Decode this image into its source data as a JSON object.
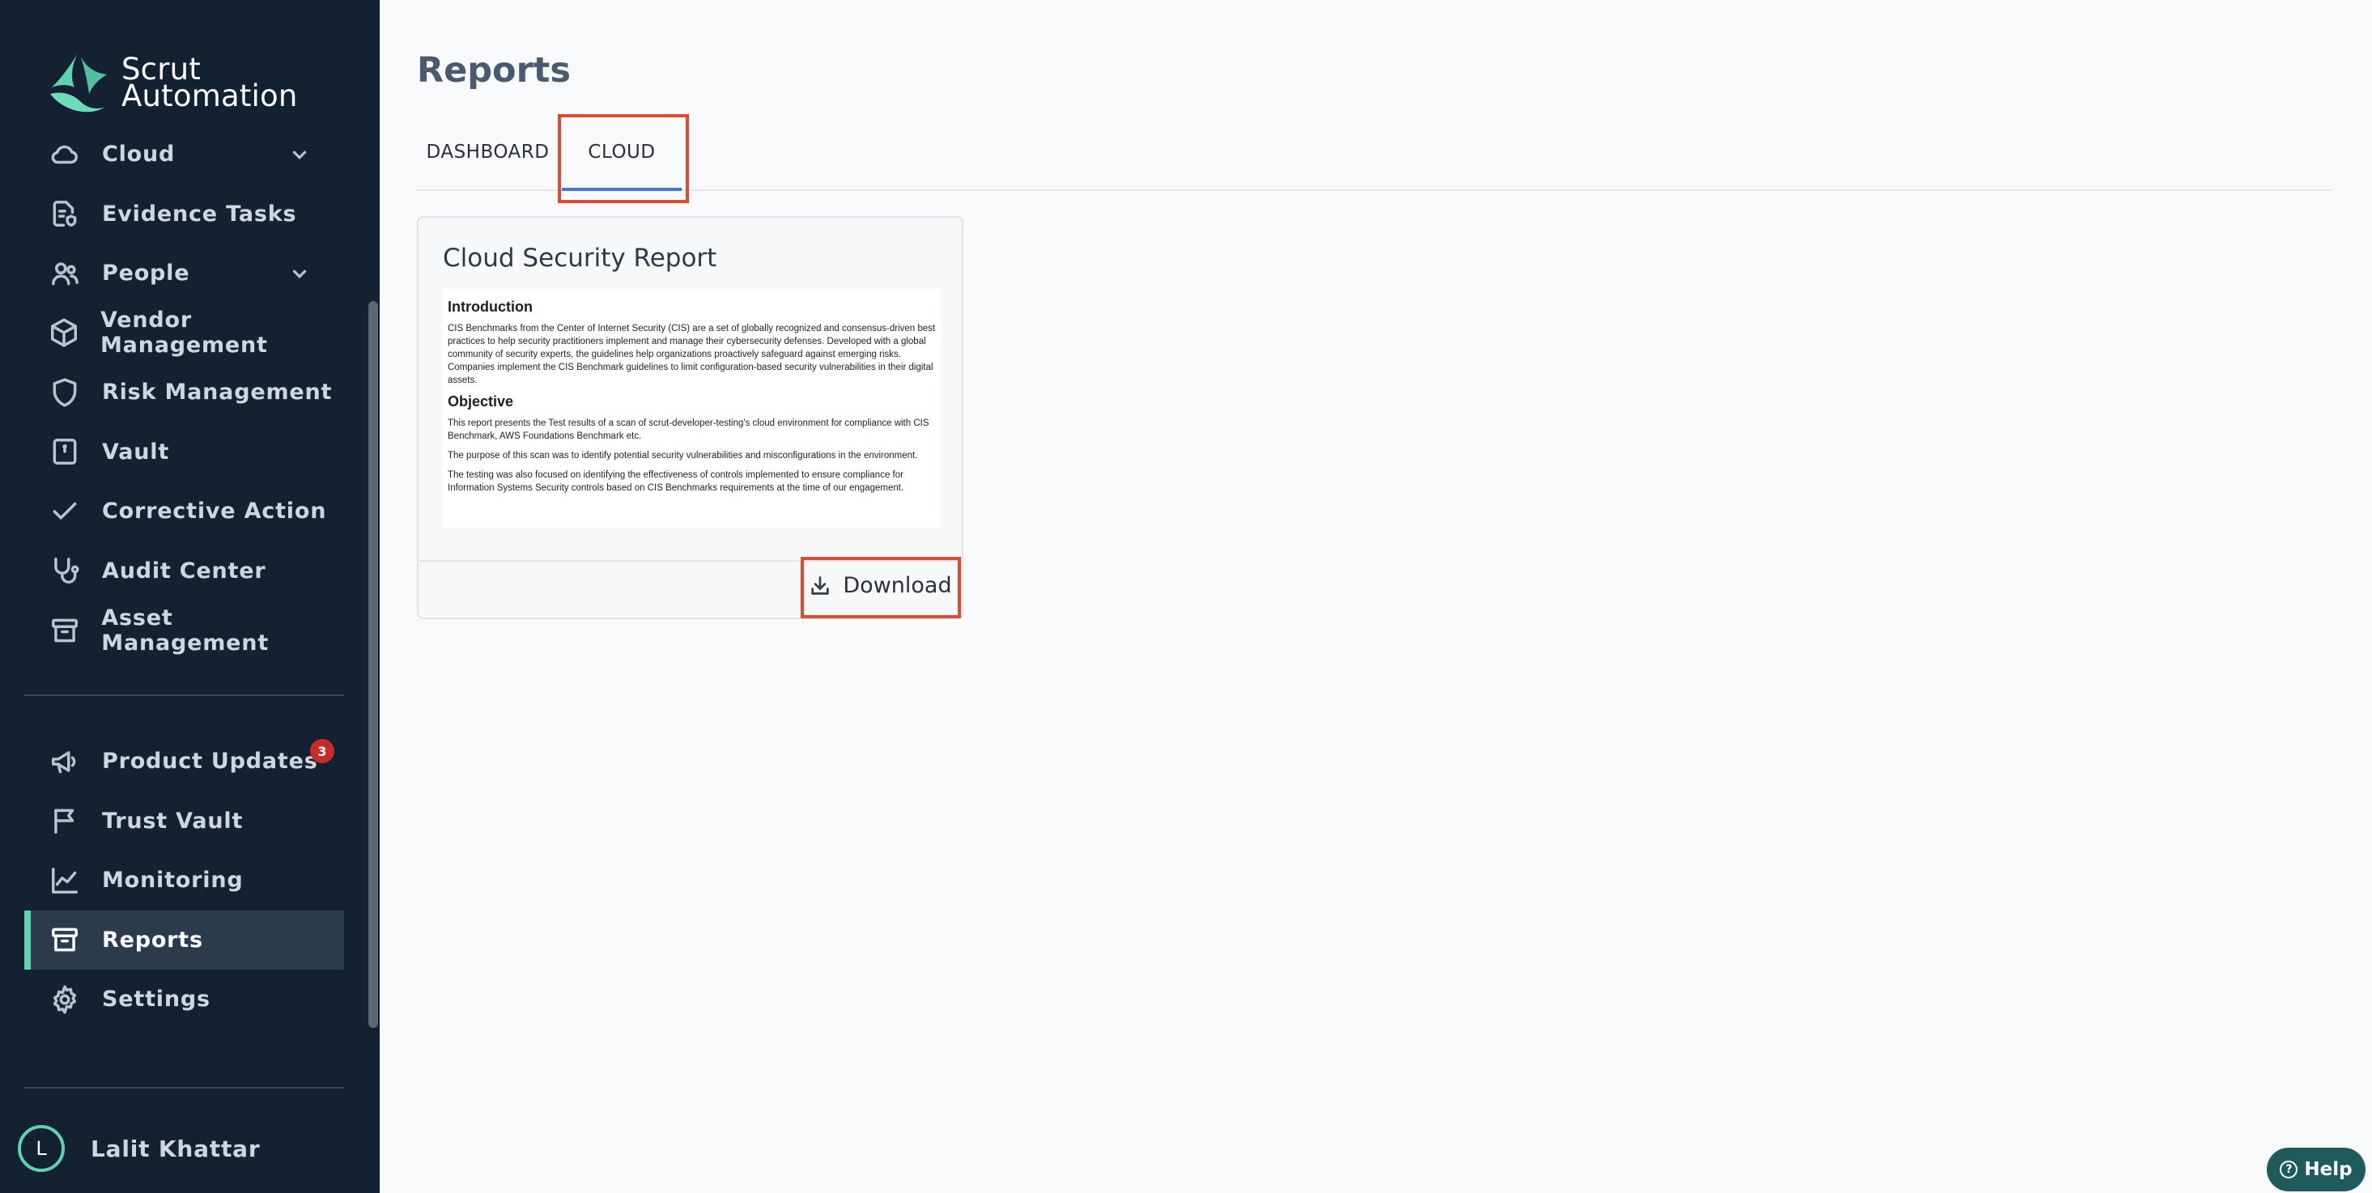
{
  "brand": {
    "line1": "Scrut",
    "line2": "Automation"
  },
  "sidebar": {
    "items": [
      {
        "label": "Cloud",
        "icon": "cloud-icon",
        "has_chevron": true
      },
      {
        "label": "Evidence Tasks",
        "icon": "document-shield-icon"
      },
      {
        "label": "People",
        "icon": "people-icon",
        "has_chevron": true
      },
      {
        "label": "Vendor Management",
        "icon": "box-icon"
      },
      {
        "label": "Risk Management",
        "icon": "shield-icon"
      },
      {
        "label": "Vault",
        "icon": "vault-icon"
      },
      {
        "label": "Corrective Action",
        "icon": "check-icon"
      },
      {
        "label": "Audit Center",
        "icon": "stethoscope-icon"
      },
      {
        "label": "Asset Management",
        "icon": "archive-icon"
      }
    ],
    "bottom_items": [
      {
        "label": "Product Updates",
        "icon": "megaphone-icon",
        "badge": "3"
      },
      {
        "label": "Trust Vault",
        "icon": "flag-icon"
      },
      {
        "label": "Monitoring",
        "icon": "chart-icon"
      },
      {
        "label": "Reports",
        "icon": "archive-icon",
        "active": true
      },
      {
        "label": "Settings",
        "icon": "gear-icon"
      }
    ],
    "user": {
      "initial": "L",
      "name": "Lalit Khattar"
    }
  },
  "main": {
    "title": "Reports",
    "tabs": [
      {
        "label": "DASHBOARD"
      },
      {
        "label": "CLOUD",
        "active": true
      }
    ],
    "card": {
      "title": "Cloud Security Report",
      "preview": {
        "h1": "Introduction",
        "p1": "CIS Benchmarks from the Center of Internet Security (CIS) are a set of globally recognized and consensus-driven best practices to help security practitioners implement and manage their cybersecurity defenses. Developed with a global community of security experts, the guidelines help organizations proactively safeguard against emerging risks. Companies implement the CIS Benchmark guidelines to limit configuration-based security vulnerabilities in their digital assets.",
        "h2": "Objective",
        "p2": "This report presents the Test results of a scan of scrut-developer-testing's cloud environment for compliance with CIS Benchmark, AWS Foundations Benchmark etc.",
        "p3": "The purpose of this scan was to identify potential security vulnerabilities and misconfigurations in the environment.",
        "p4": "The testing was also focused on identifying the effectiveness of controls implemented to ensure compliance for Information Systems Security controls based on CIS Benchmarks requirements at the time of our engagement."
      },
      "download_label": "Download"
    }
  },
  "help_label": "Help",
  "colors": {
    "sidebar_bg": "#142133",
    "accent": "#5fd3ad",
    "tab_underline": "#3f78d6",
    "highlight": "#e04a2e",
    "badge": "#c92a2a"
  }
}
